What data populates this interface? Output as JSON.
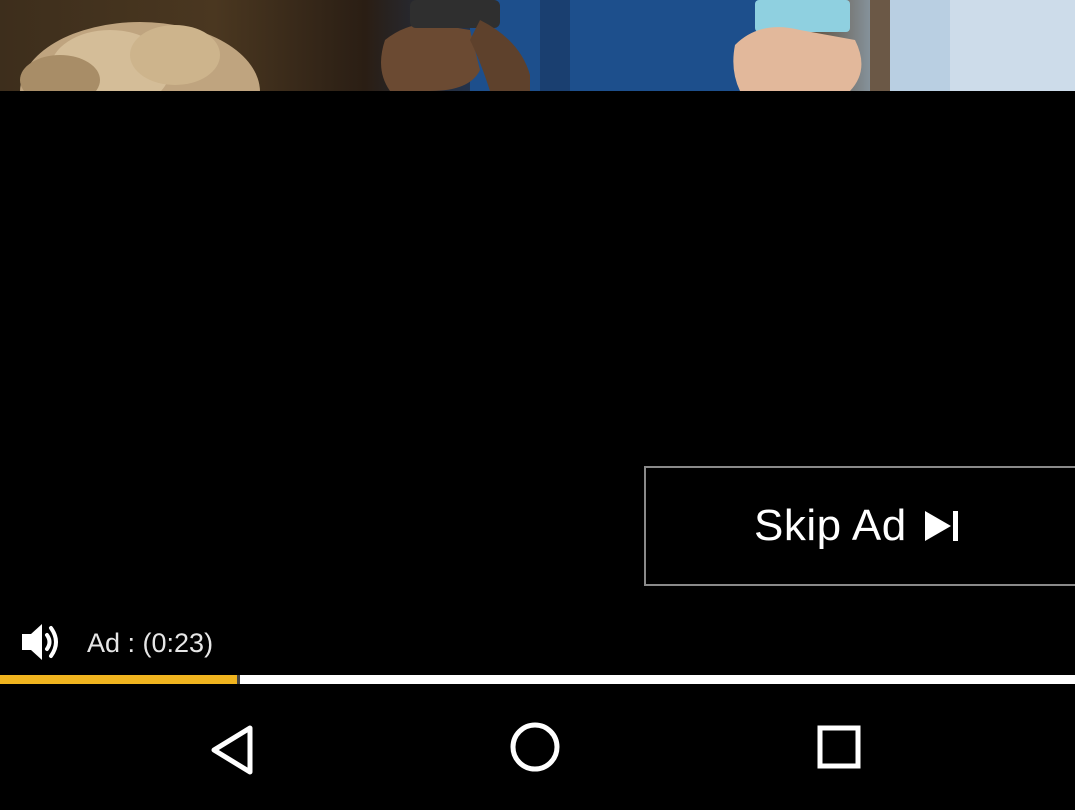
{
  "video": {
    "frame_description_icon": "video-frame-image"
  },
  "ad": {
    "skip_label": "Skip Ad",
    "skip_icon": "skip-next-icon",
    "timer_text": "Ad : (0:23)",
    "volume_icon": "volume-on-icon",
    "progress_fraction": 0.22
  },
  "navbar": {
    "back_icon": "back-triangle-icon",
    "home_icon": "home-circle-icon",
    "recents_icon": "recents-square-icon"
  },
  "colors": {
    "progress_played": "#f0b41f",
    "progress_track": "#ffffff",
    "background": "#000000",
    "skip_border": "#8a8a8a"
  }
}
